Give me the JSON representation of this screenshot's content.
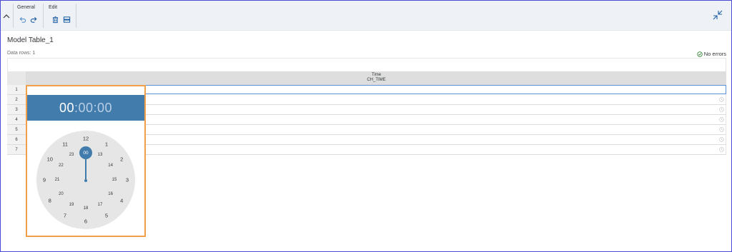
{
  "toolbar": {
    "general_label": "General",
    "edit_label": "Edit",
    "icons": [
      "undo-icon",
      "redo-icon",
      "delete-icon",
      "row-icon",
      "exit-fullscreen-icon"
    ]
  },
  "page": {
    "title": "Model Table_1",
    "data_rows": "Data rows: 1",
    "errors": "No errors"
  },
  "table": {
    "column_name": "Time",
    "column_id": "CH_TIME",
    "row_numbers": [
      "1",
      "2",
      "3",
      "4",
      "5",
      "6",
      "7"
    ],
    "row1_value": "00:00:00"
  },
  "time_picker": {
    "hours": "00",
    "sep1": ":",
    "minutes": "00",
    "sep2": ":",
    "seconds": "00",
    "selected_hour": "00",
    "outer": [
      "12",
      "1",
      "2",
      "3",
      "4",
      "5",
      "6",
      "7",
      "8",
      "9",
      "10",
      "11"
    ],
    "inner": [
      "13",
      "14",
      "15",
      "16",
      "17",
      "18",
      "19",
      "20",
      "21",
      "22",
      "23"
    ]
  },
  "colors": {
    "accent": "#427cac",
    "popup_border": "#f0a04b",
    "frame": "#4b4bd6"
  }
}
